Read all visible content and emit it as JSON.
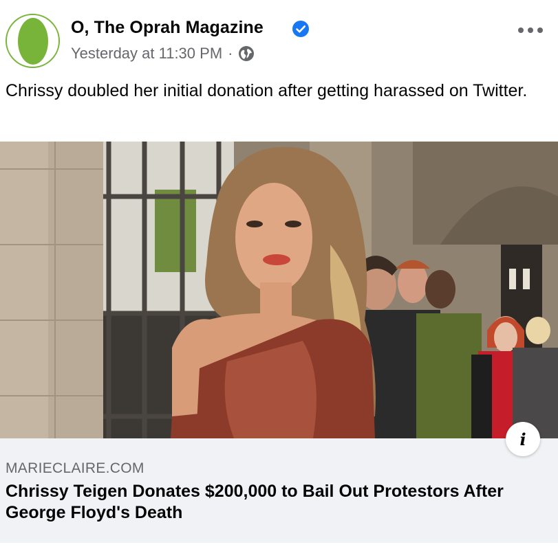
{
  "post": {
    "page_name": "O, The Oprah Magazine",
    "timestamp": "Yesterday at 11:30 PM",
    "separator": "·",
    "audience_icon": "globe-icon",
    "verified_icon": "verified-badge-icon",
    "more_icon": "more-options-icon",
    "message": "Chrissy doubled her initial donation after getting harassed on Twitter."
  },
  "link_preview": {
    "info_label": "i",
    "domain": "MARIECLAIRE.COM",
    "headline": "Chrissy Teigen Donates $200,000 to Bail Out Protestors After George Floyd's Death"
  },
  "colors": {
    "brand_green": "#79b43a",
    "verified_blue": "#1877f2",
    "secondary_text": "#65676b",
    "caption_bg": "#f0f2f5"
  }
}
